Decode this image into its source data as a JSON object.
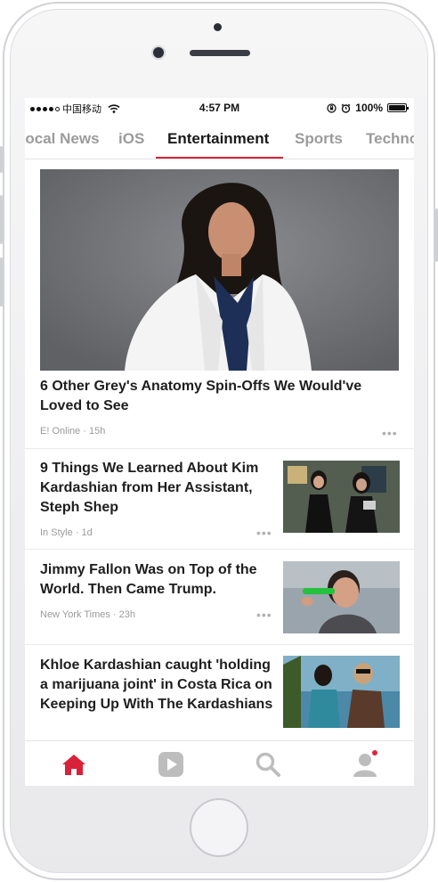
{
  "status_bar": {
    "carrier": "中国移动",
    "time": "4:57 PM",
    "battery": "100%",
    "battery_level": 1.0,
    "signal_bars": 4
  },
  "tabs": [
    {
      "label": "Local News",
      "active": false
    },
    {
      "label": "iOS",
      "active": false
    },
    {
      "label": "Entertainment",
      "active": true
    },
    {
      "label": "Sports",
      "active": false
    },
    {
      "label": "Technology",
      "active": false
    }
  ],
  "hero": {
    "title": "6 Other Grey's Anatomy Spin-Offs We Would've Loved to See",
    "source": "E! Online · 15h",
    "image": "woman-in-white-doctor-coat-photo"
  },
  "stories": [
    {
      "title": "9 Things We Learned About Kim Kardashian from Her Assistant, Steph Shep",
      "source": "In Style · 1d",
      "image": "two-women-in-black-outfits-photo"
    },
    {
      "title": "Jimmy Fallon Was on Top of the World. Then Came Trump.",
      "source": "New York Times · 23h",
      "image": "man-holding-green-glasses-photo"
    },
    {
      "title": "Khloe Kardashian caught 'holding a marijuana joint' in Costa Rica on Keeping Up With The Kardashians",
      "source": "",
      "image": "two-people-by-the-sea-photo"
    }
  ],
  "more_label": "•••",
  "bottom_nav": [
    {
      "name": "home",
      "icon": "home-icon",
      "active": true
    },
    {
      "name": "video",
      "icon": "play-icon",
      "active": false
    },
    {
      "name": "search",
      "icon": "search-icon",
      "active": false
    },
    {
      "name": "profile",
      "icon": "user-icon",
      "active": false,
      "badge": true
    }
  ],
  "colors": {
    "accent": "#d9213a",
    "inactive_icon": "#bdbdbd",
    "text_primary": "#1e1e1e",
    "text_secondary": "#9a9a9a"
  }
}
